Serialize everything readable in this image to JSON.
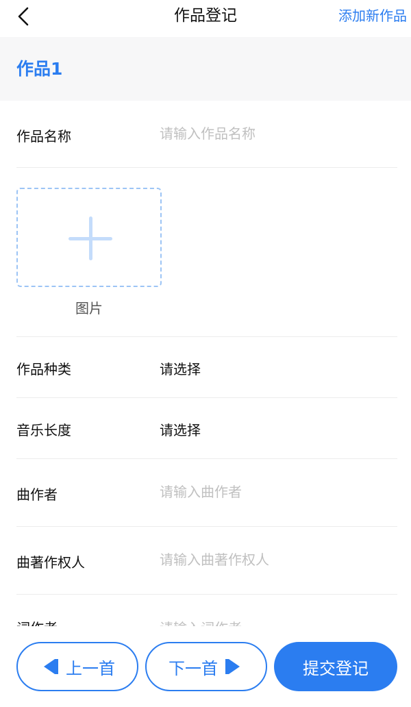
{
  "nav": {
    "back_icon": "chevron-left-icon",
    "title": "作品登记",
    "action_label": "添加新作品"
  },
  "section": {
    "title": "作品1"
  },
  "form": {
    "work_name": {
      "label": "作品名称",
      "placeholder": "请输入作品名称"
    },
    "image": {
      "label": "图片",
      "icon": "plus-icon"
    },
    "work_type": {
      "label": "作品种类",
      "value": "请选择"
    },
    "music_length": {
      "label": "音乐长度",
      "value": "请选择"
    },
    "composer": {
      "label": "曲作者",
      "placeholder": "请输入曲作者"
    },
    "composer_copyright": {
      "label": "曲著作权人",
      "placeholder": "请输入曲著作权人"
    },
    "lyricist": {
      "label": "词作者",
      "placeholder": "请输入词作者"
    }
  },
  "footer": {
    "prev_label": "上一首",
    "prev_icon": "skip-previous-icon",
    "next_label": "下一首",
    "next_icon": "skip-next-icon",
    "submit_label": "提交登记"
  },
  "colors": {
    "accent": "#2b7df0",
    "placeholder": "#c0c0c0",
    "section_bg": "#f7f7f8",
    "divider": "#ececec"
  }
}
